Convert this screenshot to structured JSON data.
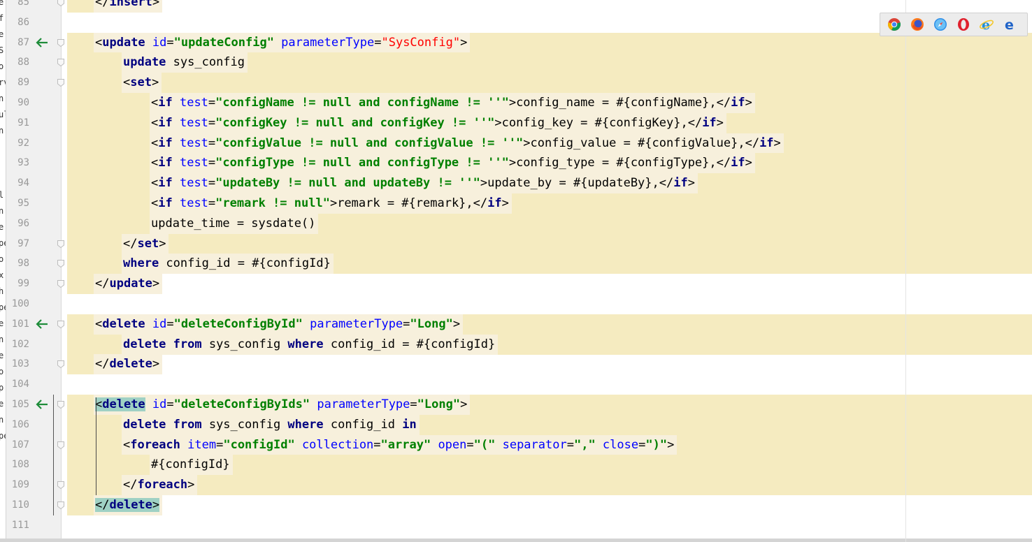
{
  "left_strip_chars": [
    "e",
    "f",
    "e",
    "S",
    "o",
    "rv",
    "n",
    "ul",
    "n",
    "",
    "",
    "",
    "l.x",
    "n",
    "e",
    "pe",
    "o",
    "x",
    "h",
    "pe",
    "e",
    "n",
    "e",
    "o",
    "p",
    "e",
    "n",
    "pe"
  ],
  "lines": [
    {
      "num": "85",
      "band": "partial",
      "bandWidth": 130,
      "tokens": [
        {
          "t": "</",
          "c": "p",
          "sp": 1
        },
        {
          "t": "insert",
          "c": "tg"
        },
        {
          "t": ">",
          "c": "p"
        }
      ],
      "indent": 1,
      "fold": true
    },
    {
      "num": "86",
      "band": "none",
      "tokens": [],
      "indent": 0
    },
    {
      "num": "87",
      "band": "full",
      "arrow": true,
      "fold": true,
      "indent": 1,
      "segw": 520,
      "tokens": [
        {
          "t": "<",
          "c": "p"
        },
        {
          "t": "update",
          "c": "tg"
        },
        {
          "t": " id",
          "c": "ab"
        },
        {
          "t": "=",
          "c": "p"
        },
        {
          "t": "\"updateConfig\"",
          "c": "av"
        },
        {
          "t": " parameterType",
          "c": "ab"
        },
        {
          "t": "=",
          "c": "p"
        },
        {
          "t": "\"SysConfig\"",
          "c": "ar"
        },
        {
          "t": ">",
          "c": "p"
        }
      ]
    },
    {
      "num": "88",
      "band": "full",
      "fold": true,
      "indent": 2,
      "tokens": [
        {
          "t": "update",
          "c": "kw"
        },
        {
          "t": " sys_config",
          "c": "p"
        }
      ]
    },
    {
      "num": "89",
      "band": "full",
      "fold": true,
      "indent": 2,
      "tokens": [
        {
          "t": "<",
          "c": "p"
        },
        {
          "t": "set",
          "c": "tg"
        },
        {
          "t": ">",
          "c": "p"
        }
      ]
    },
    {
      "num": "90",
      "band": "full",
      "indent": 3,
      "tokens": [
        {
          "t": "<",
          "c": "p"
        },
        {
          "t": "if",
          "c": "tg"
        },
        {
          "t": " test",
          "c": "ab"
        },
        {
          "t": "=",
          "c": "p"
        },
        {
          "t": "\"configName != null and configName != ''\"",
          "c": "av"
        },
        {
          "t": ">",
          "c": "p"
        },
        {
          "t": "config_name = #{configName},",
          "c": "p"
        },
        {
          "t": "</",
          "c": "p"
        },
        {
          "t": "if",
          "c": "tg"
        },
        {
          "t": ">",
          "c": "p"
        }
      ]
    },
    {
      "num": "91",
      "band": "full",
      "indent": 3,
      "tokens": [
        {
          "t": "<",
          "c": "p"
        },
        {
          "t": "if",
          "c": "tg"
        },
        {
          "t": " test",
          "c": "ab"
        },
        {
          "t": "=",
          "c": "p"
        },
        {
          "t": "\"configKey != null and configKey != ''\"",
          "c": "av"
        },
        {
          "t": ">",
          "c": "p"
        },
        {
          "t": "config_key = #{configKey},",
          "c": "p"
        },
        {
          "t": "</",
          "c": "p"
        },
        {
          "t": "if",
          "c": "tg"
        },
        {
          "t": ">",
          "c": "p"
        }
      ]
    },
    {
      "num": "92",
      "band": "full",
      "indent": 3,
      "tokens": [
        {
          "t": "<",
          "c": "p"
        },
        {
          "t": "if",
          "c": "tg"
        },
        {
          "t": " test",
          "c": "ab"
        },
        {
          "t": "=",
          "c": "p"
        },
        {
          "t": "\"configValue != null and configValue != ''\"",
          "c": "av"
        },
        {
          "t": ">",
          "c": "p"
        },
        {
          "t": "config_value = #{configValue},",
          "c": "p"
        },
        {
          "t": "</",
          "c": "p"
        },
        {
          "t": "if",
          "c": "tg"
        },
        {
          "t": ">",
          "c": "p"
        }
      ]
    },
    {
      "num": "93",
      "band": "full",
      "indent": 3,
      "tokens": [
        {
          "t": "<",
          "c": "p"
        },
        {
          "t": "if",
          "c": "tg"
        },
        {
          "t": " test",
          "c": "ab"
        },
        {
          "t": "=",
          "c": "p"
        },
        {
          "t": "\"configType != null and configType != ''\"",
          "c": "av"
        },
        {
          "t": ">",
          "c": "p"
        },
        {
          "t": "config_type = #{configType},",
          "c": "p"
        },
        {
          "t": "</",
          "c": "p"
        },
        {
          "t": "if",
          "c": "tg"
        },
        {
          "t": ">",
          "c": "p"
        }
      ]
    },
    {
      "num": "94",
      "band": "full",
      "indent": 3,
      "tokens": [
        {
          "t": "<",
          "c": "p"
        },
        {
          "t": "if",
          "c": "tg"
        },
        {
          "t": " test",
          "c": "ab"
        },
        {
          "t": "=",
          "c": "p"
        },
        {
          "t": "\"updateBy != null and updateBy != ''\"",
          "c": "av"
        },
        {
          "t": ">",
          "c": "p"
        },
        {
          "t": "update_by = #{updateBy},",
          "c": "p"
        },
        {
          "t": "</",
          "c": "p"
        },
        {
          "t": "if",
          "c": "tg"
        },
        {
          "t": ">",
          "c": "p"
        }
      ]
    },
    {
      "num": "95",
      "band": "full",
      "indent": 3,
      "tokens": [
        {
          "t": "<",
          "c": "p"
        },
        {
          "t": "if",
          "c": "tg"
        },
        {
          "t": " test",
          "c": "ab"
        },
        {
          "t": "=",
          "c": "p"
        },
        {
          "t": "\"remark != null\"",
          "c": "av"
        },
        {
          "t": ">",
          "c": "p"
        },
        {
          "t": "remark = #{remark},",
          "c": "p"
        },
        {
          "t": "</",
          "c": "p"
        },
        {
          "t": "if",
          "c": "tg"
        },
        {
          "t": ">",
          "c": "p"
        }
      ]
    },
    {
      "num": "96",
      "band": "full",
      "indent": 3,
      "tokens": [
        {
          "t": "update_time = sysdate()",
          "c": "p"
        }
      ]
    },
    {
      "num": "97",
      "band": "full",
      "fold": true,
      "indent": 2,
      "tokens": [
        {
          "t": "</",
          "c": "p"
        },
        {
          "t": "set",
          "c": "tg"
        },
        {
          "t": ">",
          "c": "p"
        }
      ]
    },
    {
      "num": "98",
      "band": "full",
      "fold": true,
      "indent": 2,
      "tokens": [
        {
          "t": "where",
          "c": "kw"
        },
        {
          "t": " config_id = #{configId}",
          "c": "p"
        }
      ]
    },
    {
      "num": "99",
      "band": "partial",
      "bandWidth": 130,
      "fold": true,
      "indent": 1,
      "tokens": [
        {
          "t": "</",
          "c": "p"
        },
        {
          "t": "update",
          "c": "tg"
        },
        {
          "t": ">",
          "c": "p"
        }
      ]
    },
    {
      "num": "100",
      "band": "none",
      "tokens": [],
      "indent": 0
    },
    {
      "num": "101",
      "band": "full",
      "arrow": true,
      "fold": true,
      "indent": 1,
      "segw": 550,
      "tokens": [
        {
          "t": "<",
          "c": "p"
        },
        {
          "t": "delete",
          "c": "tg"
        },
        {
          "t": " id",
          "c": "ab"
        },
        {
          "t": "=",
          "c": "p"
        },
        {
          "t": "\"deleteConfigById\"",
          "c": "av"
        },
        {
          "t": " parameterType",
          "c": "ab"
        },
        {
          "t": "=",
          "c": "p"
        },
        {
          "t": "\"Long\"",
          "c": "av"
        },
        {
          "t": ">",
          "c": "p"
        }
      ]
    },
    {
      "num": "102",
      "band": "full",
      "indent": 2,
      "tokens": [
        {
          "t": "delete from",
          "c": "kw"
        },
        {
          "t": " sys_config ",
          "c": "p"
        },
        {
          "t": "where",
          "c": "kw"
        },
        {
          "t": " config_id = #{configId}",
          "c": "p"
        }
      ]
    },
    {
      "num": "103",
      "band": "partial",
      "bandWidth": 130,
      "fold": true,
      "indent": 1,
      "tokens": [
        {
          "t": "</",
          "c": "p"
        },
        {
          "t": "delete",
          "c": "tg"
        },
        {
          "t": ">",
          "c": "p"
        }
      ]
    },
    {
      "num": "104",
      "band": "none",
      "tokens": [],
      "indent": 0
    },
    {
      "num": "105",
      "band": "full",
      "arrow": true,
      "fold": true,
      "indent": 1,
      "segw": 560,
      "hlopen": true,
      "tokens": [
        {
          "t": "<",
          "c": "p",
          "hl": 1
        },
        {
          "t": "delete",
          "c": "tg",
          "hl": 1
        },
        {
          "t": " id",
          "c": "ab"
        },
        {
          "t": "=",
          "c": "p"
        },
        {
          "t": "\"deleteConfigByIds\"",
          "c": "av"
        },
        {
          "t": " parameterType",
          "c": "ab"
        },
        {
          "t": "=",
          "c": "p"
        },
        {
          "t": "\"Long\"",
          "c": "av"
        },
        {
          "t": ">",
          "c": "p"
        }
      ]
    },
    {
      "num": "106",
      "band": "full",
      "indent": 2,
      "tokens": [
        {
          "t": "delete from",
          "c": "kw"
        },
        {
          "t": " sys_config ",
          "c": "p"
        },
        {
          "t": "where",
          "c": "kw"
        },
        {
          "t": " config_id ",
          "c": "p"
        },
        {
          "t": "in",
          "c": "kw"
        }
      ]
    },
    {
      "num": "107",
      "band": "full",
      "fold": true,
      "indent": 2,
      "tokens": [
        {
          "t": "<",
          "c": "p"
        },
        {
          "t": "foreach",
          "c": "tg"
        },
        {
          "t": " item",
          "c": "ab"
        },
        {
          "t": "=",
          "c": "p"
        },
        {
          "t": "\"configId\"",
          "c": "av"
        },
        {
          "t": " collection",
          "c": "ab"
        },
        {
          "t": "=",
          "c": "p"
        },
        {
          "t": "\"array\"",
          "c": "av"
        },
        {
          "t": " open",
          "c": "ab"
        },
        {
          "t": "=",
          "c": "p"
        },
        {
          "t": "\"(\"",
          "c": "av"
        },
        {
          "t": " separator",
          "c": "ab"
        },
        {
          "t": "=",
          "c": "p"
        },
        {
          "t": "\",\"",
          "c": "av"
        },
        {
          "t": " close",
          "c": "ab"
        },
        {
          "t": "=",
          "c": "p"
        },
        {
          "t": "\")\"",
          "c": "av"
        },
        {
          "t": ">",
          "c": "p"
        }
      ]
    },
    {
      "num": "108",
      "band": "full",
      "indent": 3,
      "tokens": [
        {
          "t": "#{configId}",
          "c": "p"
        }
      ]
    },
    {
      "num": "109",
      "band": "full",
      "fold": true,
      "indent": 2,
      "tokens": [
        {
          "t": "</",
          "c": "p"
        },
        {
          "t": "foreach",
          "c": "tg"
        },
        {
          "t": ">",
          "c": "p"
        }
      ]
    },
    {
      "num": "110",
      "band": "partial",
      "bandWidth": 130,
      "fold": true,
      "indent": 1,
      "tokens": [
        {
          "t": "</",
          "c": "p",
          "hl": 1
        },
        {
          "t": "delete",
          "c": "tg",
          "hl": 1
        },
        {
          "t": ">",
          "c": "p",
          "hl": 1
        }
      ]
    },
    {
      "num": "111",
      "band": "none",
      "tokens": [],
      "indent": 0
    }
  ],
  "browser_icons": [
    "chrome-icon",
    "firefox-icon",
    "safari-icon",
    "opera-icon",
    "ie-icon",
    "edge-icon"
  ],
  "colors": {
    "band": "#f5ebc0",
    "tag": "#000080",
    "attr": "#0000ff",
    "value": "#008000",
    "highlight": "#9fd1c4",
    "arrow": "#1e8c3a"
  }
}
